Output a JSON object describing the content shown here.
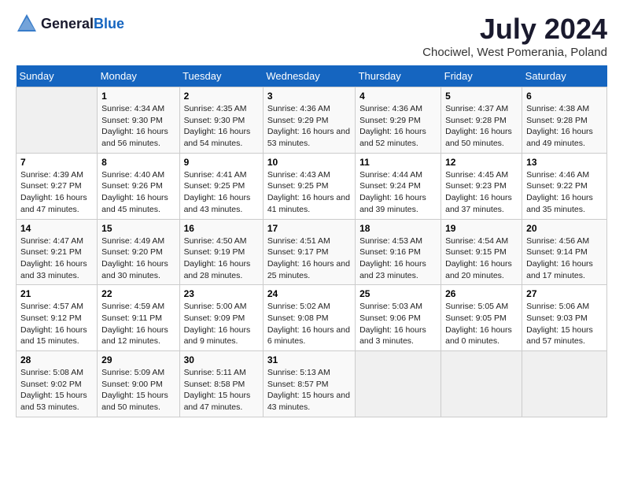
{
  "header": {
    "logo_general": "General",
    "logo_blue": "Blue",
    "title": "July 2024",
    "subtitle": "Chociwel, West Pomerania, Poland"
  },
  "calendar": {
    "days_of_week": [
      "Sunday",
      "Monday",
      "Tuesday",
      "Wednesday",
      "Thursday",
      "Friday",
      "Saturday"
    ],
    "weeks": [
      [
        {
          "day": "",
          "info": ""
        },
        {
          "day": "1",
          "info": "Sunrise: 4:34 AM\nSunset: 9:30 PM\nDaylight: 16 hours and 56 minutes."
        },
        {
          "day": "2",
          "info": "Sunrise: 4:35 AM\nSunset: 9:30 PM\nDaylight: 16 hours and 54 minutes."
        },
        {
          "day": "3",
          "info": "Sunrise: 4:36 AM\nSunset: 9:29 PM\nDaylight: 16 hours and 53 minutes."
        },
        {
          "day": "4",
          "info": "Sunrise: 4:36 AM\nSunset: 9:29 PM\nDaylight: 16 hours and 52 minutes."
        },
        {
          "day": "5",
          "info": "Sunrise: 4:37 AM\nSunset: 9:28 PM\nDaylight: 16 hours and 50 minutes."
        },
        {
          "day": "6",
          "info": "Sunrise: 4:38 AM\nSunset: 9:28 PM\nDaylight: 16 hours and 49 minutes."
        }
      ],
      [
        {
          "day": "7",
          "info": "Sunrise: 4:39 AM\nSunset: 9:27 PM\nDaylight: 16 hours and 47 minutes."
        },
        {
          "day": "8",
          "info": "Sunrise: 4:40 AM\nSunset: 9:26 PM\nDaylight: 16 hours and 45 minutes."
        },
        {
          "day": "9",
          "info": "Sunrise: 4:41 AM\nSunset: 9:25 PM\nDaylight: 16 hours and 43 minutes."
        },
        {
          "day": "10",
          "info": "Sunrise: 4:43 AM\nSunset: 9:25 PM\nDaylight: 16 hours and 41 minutes."
        },
        {
          "day": "11",
          "info": "Sunrise: 4:44 AM\nSunset: 9:24 PM\nDaylight: 16 hours and 39 minutes."
        },
        {
          "day": "12",
          "info": "Sunrise: 4:45 AM\nSunset: 9:23 PM\nDaylight: 16 hours and 37 minutes."
        },
        {
          "day": "13",
          "info": "Sunrise: 4:46 AM\nSunset: 9:22 PM\nDaylight: 16 hours and 35 minutes."
        }
      ],
      [
        {
          "day": "14",
          "info": "Sunrise: 4:47 AM\nSunset: 9:21 PM\nDaylight: 16 hours and 33 minutes."
        },
        {
          "day": "15",
          "info": "Sunrise: 4:49 AM\nSunset: 9:20 PM\nDaylight: 16 hours and 30 minutes."
        },
        {
          "day": "16",
          "info": "Sunrise: 4:50 AM\nSunset: 9:19 PM\nDaylight: 16 hours and 28 minutes."
        },
        {
          "day": "17",
          "info": "Sunrise: 4:51 AM\nSunset: 9:17 PM\nDaylight: 16 hours and 25 minutes."
        },
        {
          "day": "18",
          "info": "Sunrise: 4:53 AM\nSunset: 9:16 PM\nDaylight: 16 hours and 23 minutes."
        },
        {
          "day": "19",
          "info": "Sunrise: 4:54 AM\nSunset: 9:15 PM\nDaylight: 16 hours and 20 minutes."
        },
        {
          "day": "20",
          "info": "Sunrise: 4:56 AM\nSunset: 9:14 PM\nDaylight: 16 hours and 17 minutes."
        }
      ],
      [
        {
          "day": "21",
          "info": "Sunrise: 4:57 AM\nSunset: 9:12 PM\nDaylight: 16 hours and 15 minutes."
        },
        {
          "day": "22",
          "info": "Sunrise: 4:59 AM\nSunset: 9:11 PM\nDaylight: 16 hours and 12 minutes."
        },
        {
          "day": "23",
          "info": "Sunrise: 5:00 AM\nSunset: 9:09 PM\nDaylight: 16 hours and 9 minutes."
        },
        {
          "day": "24",
          "info": "Sunrise: 5:02 AM\nSunset: 9:08 PM\nDaylight: 16 hours and 6 minutes."
        },
        {
          "day": "25",
          "info": "Sunrise: 5:03 AM\nSunset: 9:06 PM\nDaylight: 16 hours and 3 minutes."
        },
        {
          "day": "26",
          "info": "Sunrise: 5:05 AM\nSunset: 9:05 PM\nDaylight: 16 hours and 0 minutes."
        },
        {
          "day": "27",
          "info": "Sunrise: 5:06 AM\nSunset: 9:03 PM\nDaylight: 15 hours and 57 minutes."
        }
      ],
      [
        {
          "day": "28",
          "info": "Sunrise: 5:08 AM\nSunset: 9:02 PM\nDaylight: 15 hours and 53 minutes."
        },
        {
          "day": "29",
          "info": "Sunrise: 5:09 AM\nSunset: 9:00 PM\nDaylight: 15 hours and 50 minutes."
        },
        {
          "day": "30",
          "info": "Sunrise: 5:11 AM\nSunset: 8:58 PM\nDaylight: 15 hours and 47 minutes."
        },
        {
          "day": "31",
          "info": "Sunrise: 5:13 AM\nSunset: 8:57 PM\nDaylight: 15 hours and 43 minutes."
        },
        {
          "day": "",
          "info": ""
        },
        {
          "day": "",
          "info": ""
        },
        {
          "day": "",
          "info": ""
        }
      ]
    ]
  }
}
